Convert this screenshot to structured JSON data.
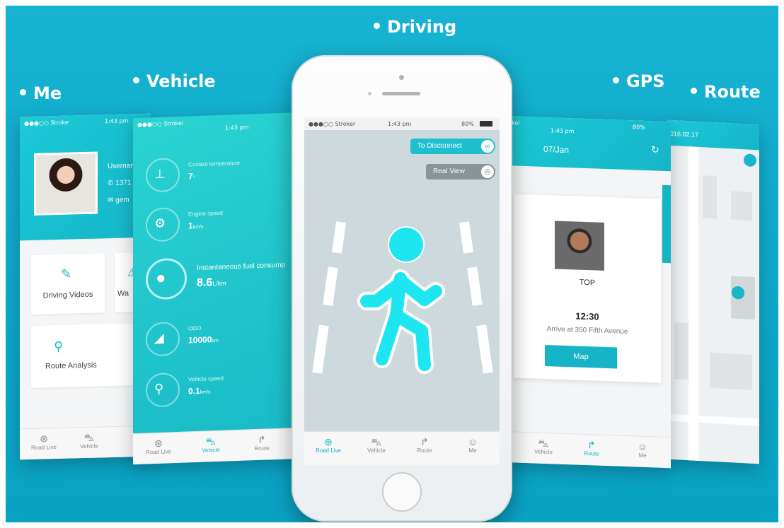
{
  "labels": {
    "me": "Me",
    "vehicle": "Vehicle",
    "driving": "Driving",
    "gps": "GPS",
    "route": "Route"
  },
  "me_screen": {
    "carrier": "●●●○○ Stroke",
    "time": "1:43 pm",
    "username": "Usernam",
    "phone": "1371",
    "email": "gem",
    "cards": {
      "driving_videos": "Driving Videos",
      "warning": "Wa",
      "route_analysis": "Route Analysis"
    },
    "tabs": [
      "Road Live",
      "Vehicle"
    ]
  },
  "vehicle_screen": {
    "carrier": "●●●○○ Strokei",
    "time": "1:43 pm",
    "metrics": [
      {
        "name": "Coolant temperature",
        "value": "7",
        "unit": "°"
      },
      {
        "name": "Engine speed",
        "value": "1",
        "unit": "km/s"
      },
      {
        "name": "Instantaneous fuel consump",
        "value": "8.6",
        "unit": "L/km"
      },
      {
        "name": "ODO",
        "value": "10000",
        "unit": "km"
      },
      {
        "name": "Vehicle speed",
        "value": "0.1",
        "unit": "km/s"
      }
    ],
    "tabs": [
      "Road Live",
      "Vehicle",
      "Route"
    ]
  },
  "driving_screen": {
    "carrier": "●●●○○ Stroker",
    "time": "1:43 pm",
    "battery": "80%",
    "disconnect": "To Disconnect",
    "real_view": "Real View",
    "tabs": [
      "Road Live",
      "Vehicle",
      "Route",
      "Me"
    ],
    "accent": "#1ee6f0"
  },
  "gps_screen": {
    "carrier": "trokei",
    "time": "1:43 pm",
    "battery": "80%",
    "date": "07/Jan",
    "top": "TOP",
    "arrival_time": "12:30",
    "arrive": "Arrive at 350 Fifth Avenue",
    "map_button": "Map",
    "tabs": [
      "ive",
      "Vehicle",
      "Route",
      "Me"
    ]
  },
  "route_screen": {
    "date": "016.02.17"
  }
}
